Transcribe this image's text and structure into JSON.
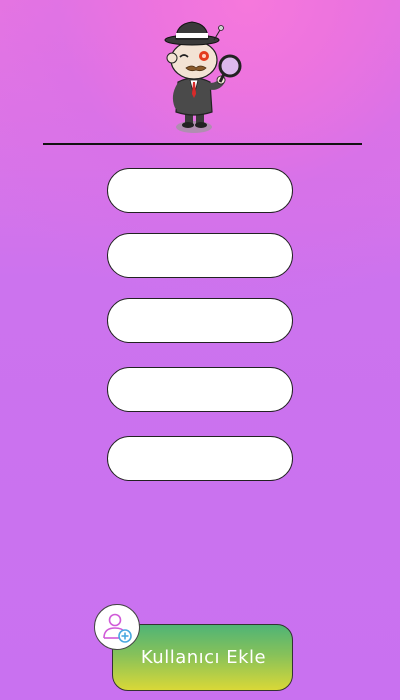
{
  "form": {
    "fields": [
      {
        "value": "",
        "placeholder": ""
      },
      {
        "value": "",
        "placeholder": ""
      },
      {
        "value": "",
        "placeholder": ""
      },
      {
        "value": "",
        "placeholder": ""
      },
      {
        "value": "",
        "placeholder": ""
      }
    ]
  },
  "actions": {
    "add_user_label": "Kullanıcı Ekle",
    "add_user_icon": "add-user-icon"
  },
  "header": {
    "mascot_icon": "detective-mascot"
  }
}
